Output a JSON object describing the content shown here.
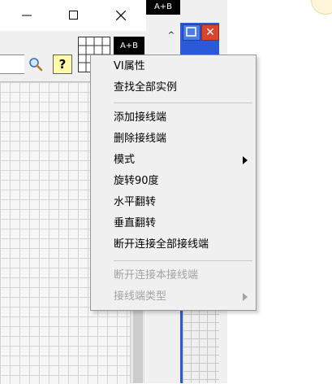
{
  "window": {
    "minimize_icon": "minimize-icon",
    "maximize_icon": "maximize-icon",
    "close_icon": "close-icon"
  },
  "toolbar": {
    "search_value": "",
    "search_icon": "magnifier-icon",
    "help_label": "?",
    "vi_icon_label": "A+B"
  },
  "second_window": {
    "icon_label": "A+B",
    "close_label": "✕",
    "scroll_up_label": "^"
  },
  "context_menu": {
    "items": [
      {
        "label": "VI属性",
        "enabled": true
      },
      {
        "label": "查找全部实例",
        "enabled": true
      },
      {
        "label": "添加接线端",
        "enabled": true
      },
      {
        "label": "删除接线端",
        "enabled": true
      },
      {
        "label": "模式",
        "enabled": true,
        "submenu": true
      },
      {
        "label": "旋转90度",
        "enabled": true
      },
      {
        "label": "水平翻转",
        "enabled": true
      },
      {
        "label": "垂直翻转",
        "enabled": true
      },
      {
        "label": "断开连接全部接线端",
        "enabled": true
      },
      {
        "label": "断开连接本接线端",
        "enabled": false
      },
      {
        "label": "接线端类型",
        "enabled": false,
        "submenu": true
      }
    ]
  },
  "colors": {
    "menu_bg": "#f0f0f0",
    "disabled_text": "#a3a3a3",
    "help_button_bg": "#fff9a8",
    "rail_blue": "#2a5ad6",
    "close_red": "#d8442d"
  }
}
